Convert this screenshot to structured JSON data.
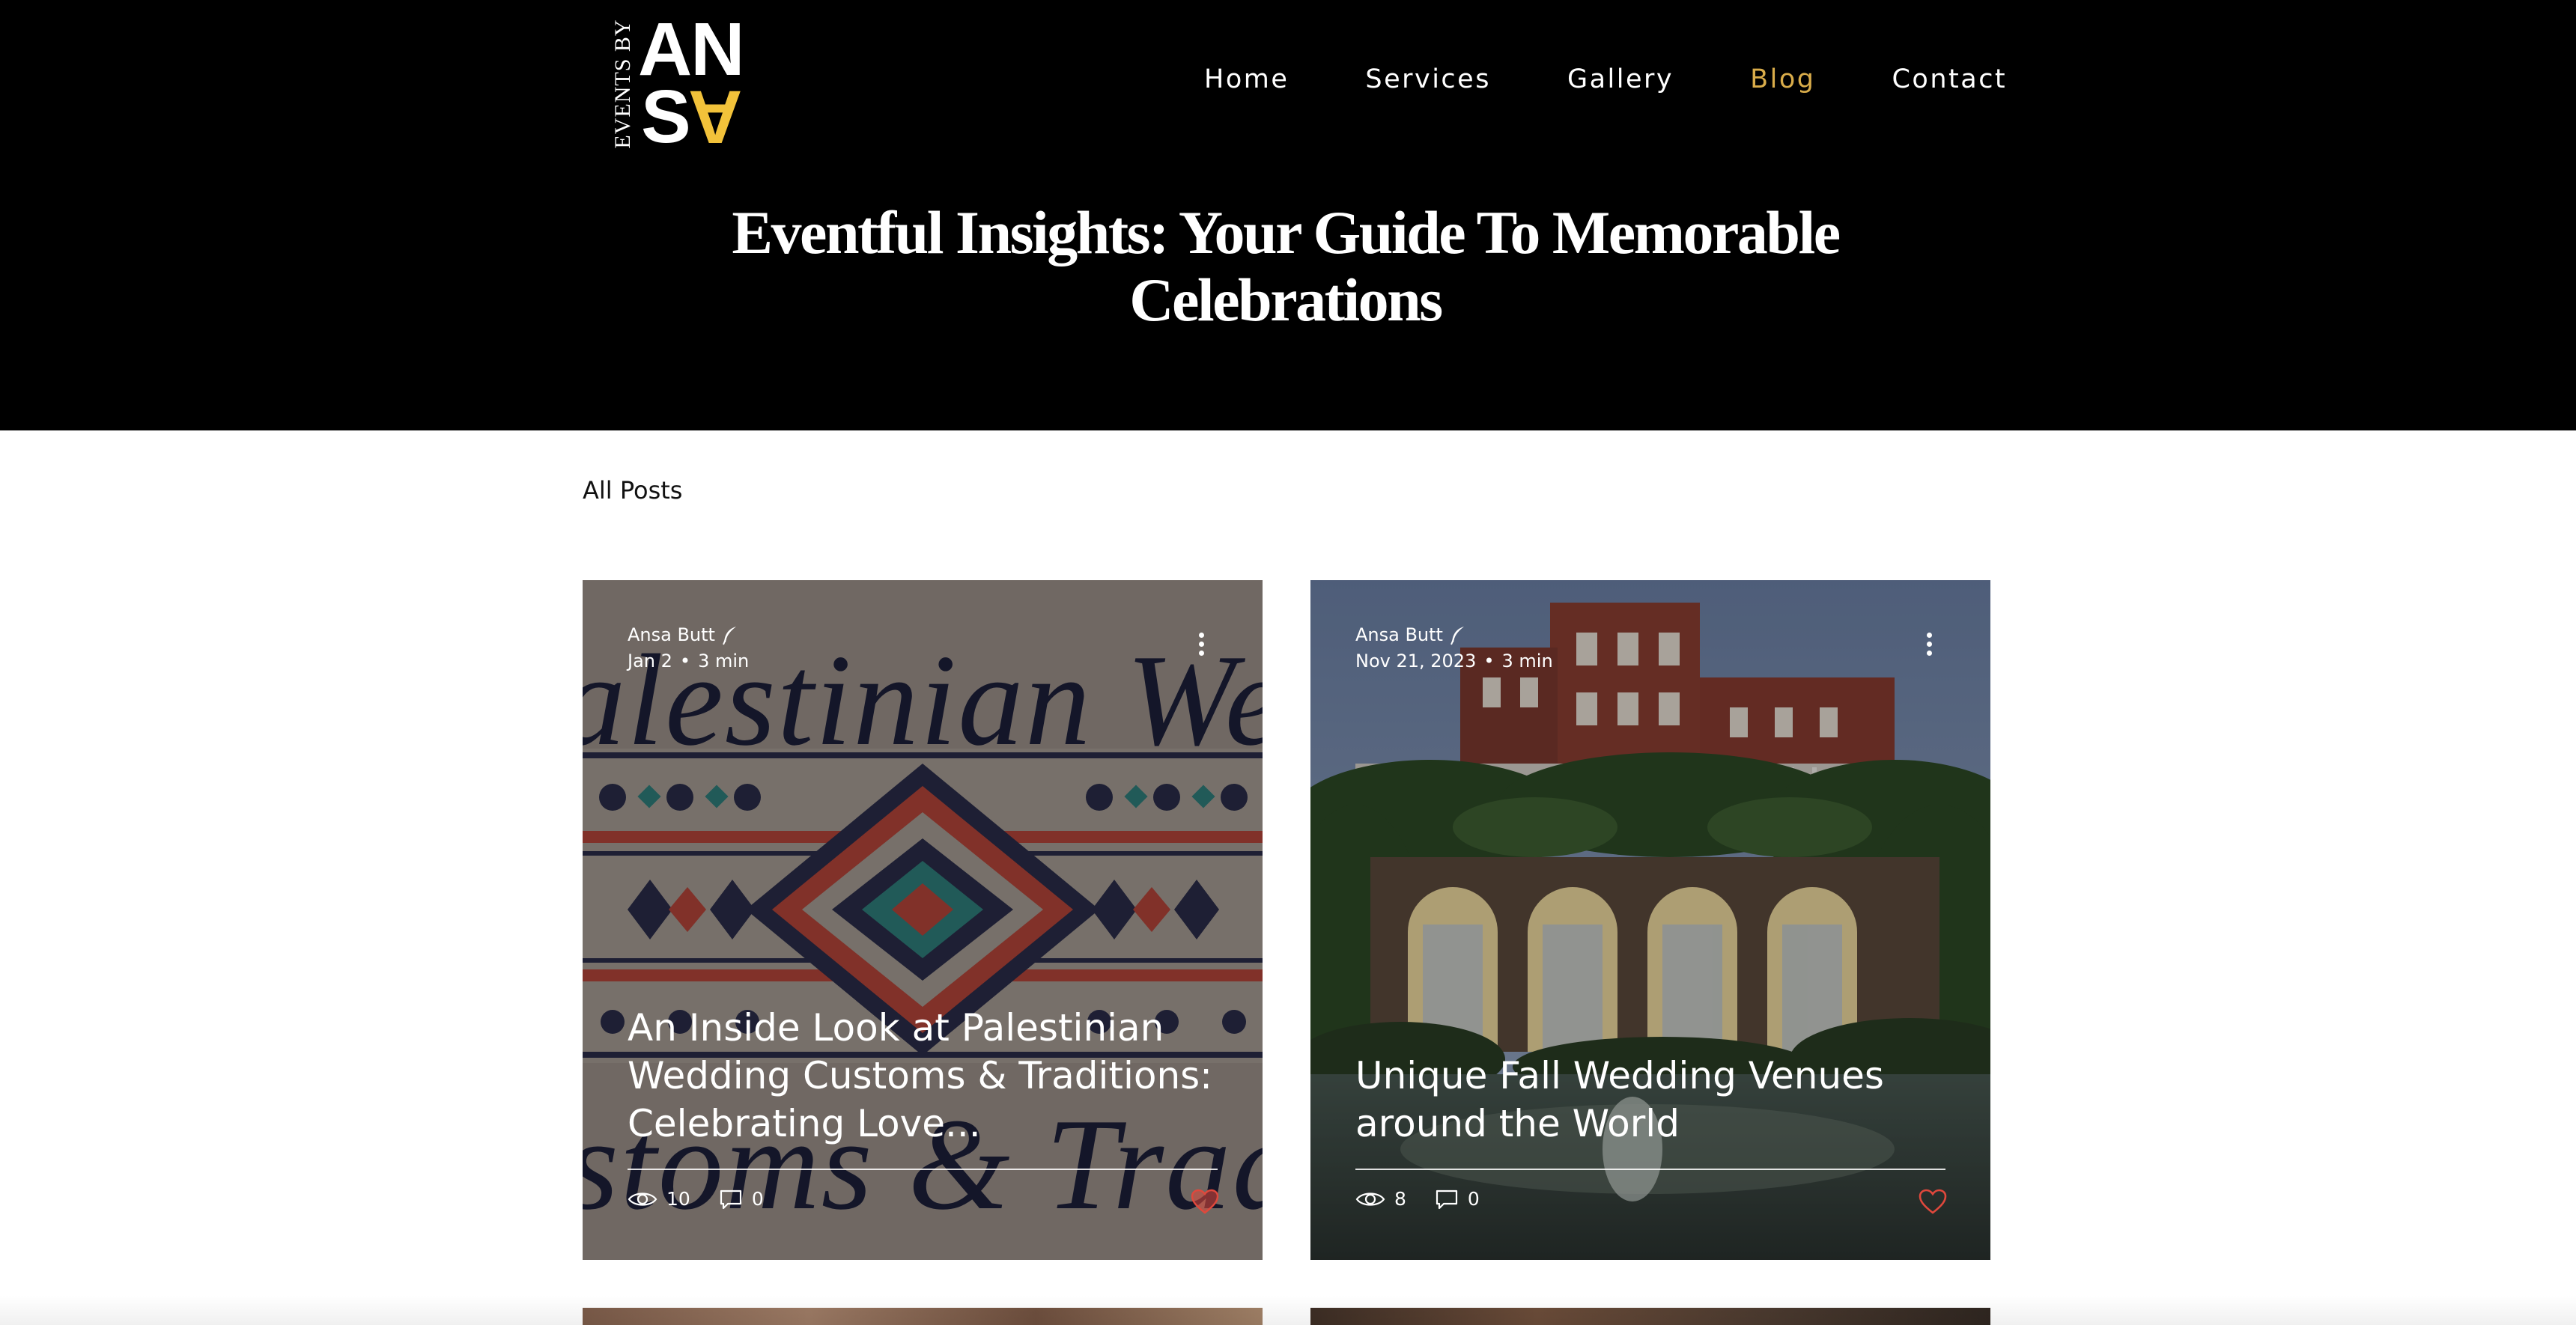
{
  "brand": {
    "logo_side_text": "EVENTS BY",
    "logo_top_text": "AN",
    "logo_bottom_s": "S",
    "logo_bottom_a": "A",
    "accent_color": "#f2c23a"
  },
  "nav": {
    "items": [
      {
        "label": "Home"
      },
      {
        "label": "Services"
      },
      {
        "label": "Gallery"
      },
      {
        "label": "Blog"
      },
      {
        "label": "Contact"
      }
    ],
    "active": "Blog",
    "active_color": "#d9ac4a"
  },
  "hero": {
    "title_line1": "Eventful Insights: Your Guide To Memorable",
    "title_line2": "Celebrations"
  },
  "filter": {
    "all_posts_label": "All Posts"
  },
  "posts": [
    {
      "author": "Ansa Butt",
      "date": "Jan 2",
      "read_time": "3 min",
      "separator": "•",
      "title": "An Inside Look at Palestinian Wedding Customs & Traditions: Celebrating Love...",
      "views": "10",
      "comments": "0",
      "liked": true,
      "image_top_text": "alestinian Weddi",
      "image_bottom_text": "stoms & Traditio",
      "icons": [
        "quill-icon",
        "more-vertical-icon",
        "eye-icon",
        "comment-icon",
        "heart-icon"
      ]
    },
    {
      "author": "Ansa Butt",
      "date": "Nov 21, 2023",
      "read_time": "3 min",
      "separator": "•",
      "title": "Unique Fall Wedding Venues around the World",
      "views": "8",
      "comments": "0",
      "liked": false,
      "icons": [
        "quill-icon",
        "more-vertical-icon",
        "eye-icon",
        "comment-icon",
        "heart-outline-icon"
      ]
    }
  ],
  "colors": {
    "header_bg": "#000000",
    "heart_red": "#e0483c"
  }
}
